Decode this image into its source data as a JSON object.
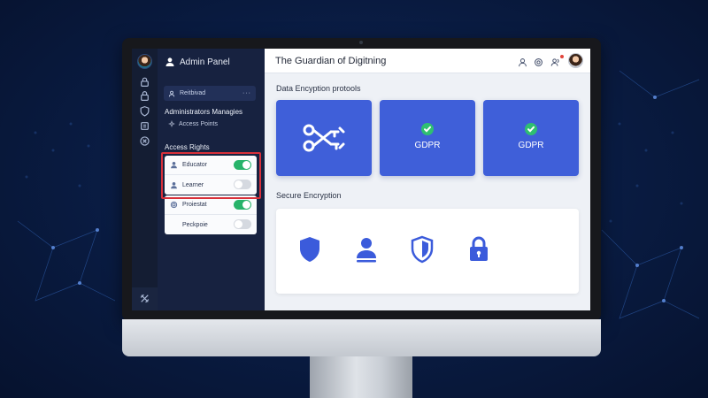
{
  "colors": {
    "background": "#0a1d45",
    "sidebar": "#172240",
    "tile": "#3f5fd9",
    "toggle_on": "#27b36a",
    "highlight": "#d8303a"
  },
  "rail": {
    "icons": [
      "user-lock-icon",
      "lock-icon",
      "shield-icon",
      "document-icon",
      "close-circle-icon",
      "tools-icon"
    ]
  },
  "sidebar": {
    "title": "Admin Panel",
    "search": {
      "label": "Reitbivad",
      "more": "···"
    },
    "admin_section": "Administrators Managies",
    "access_points": "Access Points",
    "access_rights_title": "Access Rights",
    "highlighted_rows": [
      {
        "label": "Educator",
        "icon": "person-icon",
        "toggle": true
      },
      {
        "label": "Learner",
        "icon": "person-icon",
        "toggle": false
      }
    ],
    "other_rows": [
      {
        "label": "Proiestat",
        "icon": "gear-icon",
        "toggle": true
      },
      {
        "label": "Peckpoie",
        "icon": "",
        "toggle": false
      }
    ]
  },
  "header": {
    "title": "The Guardian of Digitning",
    "icons": [
      "user-icon",
      "settings-icon",
      "users-icon",
      "avatar"
    ]
  },
  "main": {
    "protocols_title": "Data Encyption protools",
    "tiles": [
      {
        "label": "",
        "icon": "keys-icon"
      },
      {
        "label": "GDPR",
        "icon": "check-icon"
      },
      {
        "label": "GDPR",
        "icon": "check-icon"
      }
    ],
    "secure_title": "Secure Encryption",
    "secure_icons": [
      "shield-icon",
      "user-icon",
      "shield-outline-icon",
      "padlock-icon"
    ]
  }
}
